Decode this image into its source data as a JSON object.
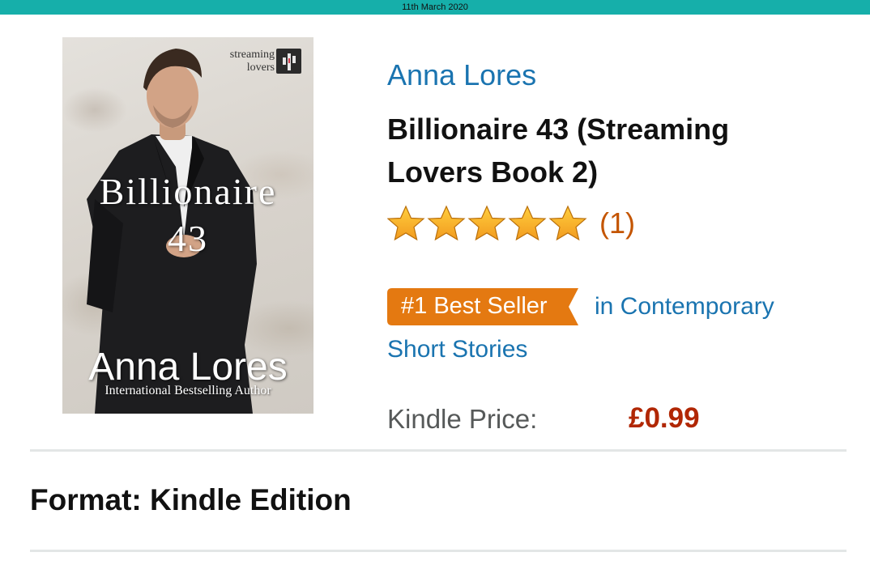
{
  "status_bar": {
    "date": "11th March 2020"
  },
  "book_cover": {
    "publisher_label": "streaming lovers",
    "title": "Billionaire",
    "number": "43",
    "author": "Anna Lores",
    "tagline": "International Bestselling Author"
  },
  "product": {
    "author": "Anna Lores",
    "title": "Billionaire 43 (Streaming Lovers Book 2)",
    "rating": {
      "stars": 5,
      "max_stars": 5,
      "count_text": "(1)",
      "star_color": "#f7a928"
    },
    "bestseller": {
      "badge": "#1 Best Seller",
      "category_line1": "in Contemporary",
      "category_line2": "Short Stories",
      "badge_color": "#e47911"
    },
    "price": {
      "label": "Kindle Price:",
      "value": "£0.99",
      "color": "#b12704"
    },
    "format": "Format: Kindle Edition"
  },
  "colors": {
    "status_bar": "#16afaa",
    "link": "#1a74b0"
  }
}
